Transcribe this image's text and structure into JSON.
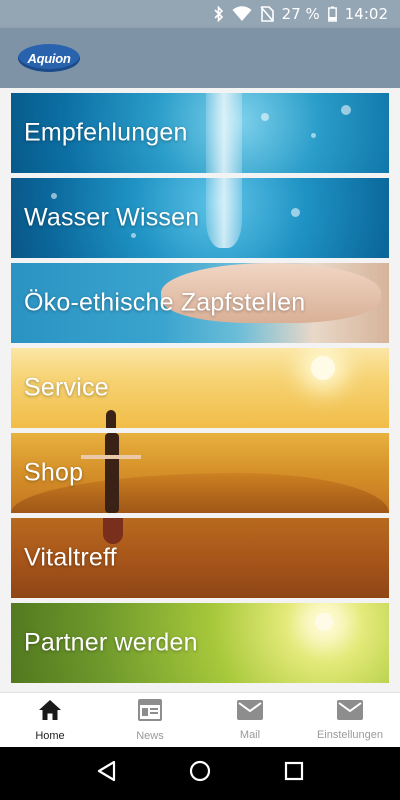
{
  "status_bar": {
    "battery": "27 %",
    "time": "14:02",
    "icons": [
      "bluetooth-icon",
      "wifi-icon",
      "no-sim-icon",
      "battery-icon"
    ]
  },
  "app_bar": {
    "logo_text": "Aquion",
    "logo_color": "#2a63ad",
    "background": "#7e94a6"
  },
  "menu": {
    "items": [
      {
        "label": "Empfehlungen"
      },
      {
        "label": "Wasser Wissen"
      },
      {
        "label": "Öko-ethische Zapfstellen"
      },
      {
        "label": "Service"
      },
      {
        "label": "Shop"
      },
      {
        "label": "Vitaltreff"
      },
      {
        "label": "Partner werden"
      }
    ]
  },
  "bottom_nav": {
    "active": "Home",
    "items": [
      {
        "label": "Home",
        "icon": "home-icon"
      },
      {
        "label": "News",
        "icon": "news-icon"
      },
      {
        "label": "Mail",
        "icon": "mail-icon"
      },
      {
        "label": "Einstellungen",
        "icon": "settings-mail-icon"
      }
    ]
  },
  "system_nav": {
    "icons": [
      "back-icon",
      "home-circle-icon",
      "recents-icon"
    ]
  }
}
